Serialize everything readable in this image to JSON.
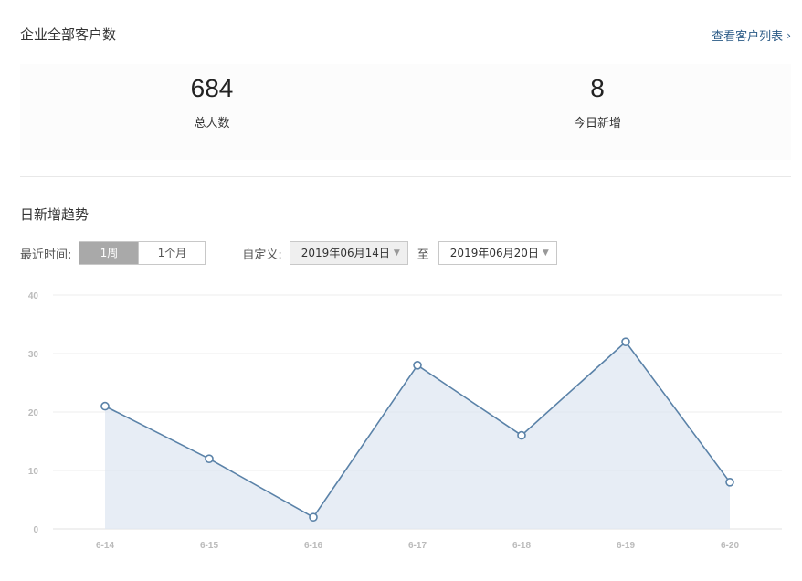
{
  "header": {
    "title": "企业全部客户数",
    "view_link": "查看客户列表",
    "view_link_icon": "chevron-right-icon"
  },
  "stats": {
    "total": {
      "value": "684",
      "label": "总人数"
    },
    "today": {
      "value": "8",
      "label": "今日新增"
    }
  },
  "trend": {
    "title": "日新增趋势",
    "recent_label": "最近时间:",
    "range_options": [
      "1周",
      "1个月"
    ],
    "selected_range": "1周",
    "custom_label": "自定义:",
    "start_date": "2019年06月14日",
    "to_label": "至",
    "end_date": "2019年06月20日"
  },
  "colors": {
    "line": "#5a82a8",
    "area": "#dfe7f1",
    "link": "#2a5a86",
    "active_segment": "#a9a9a9"
  },
  "chart_data": {
    "type": "area",
    "categories": [
      "6-14",
      "6-15",
      "6-16",
      "6-17",
      "6-18",
      "6-19",
      "6-20"
    ],
    "values": [
      21,
      12,
      2,
      28,
      16,
      32,
      8
    ],
    "ylim": [
      0,
      40
    ],
    "yticks": [
      0,
      10,
      20,
      30,
      40
    ],
    "grid": true
  }
}
